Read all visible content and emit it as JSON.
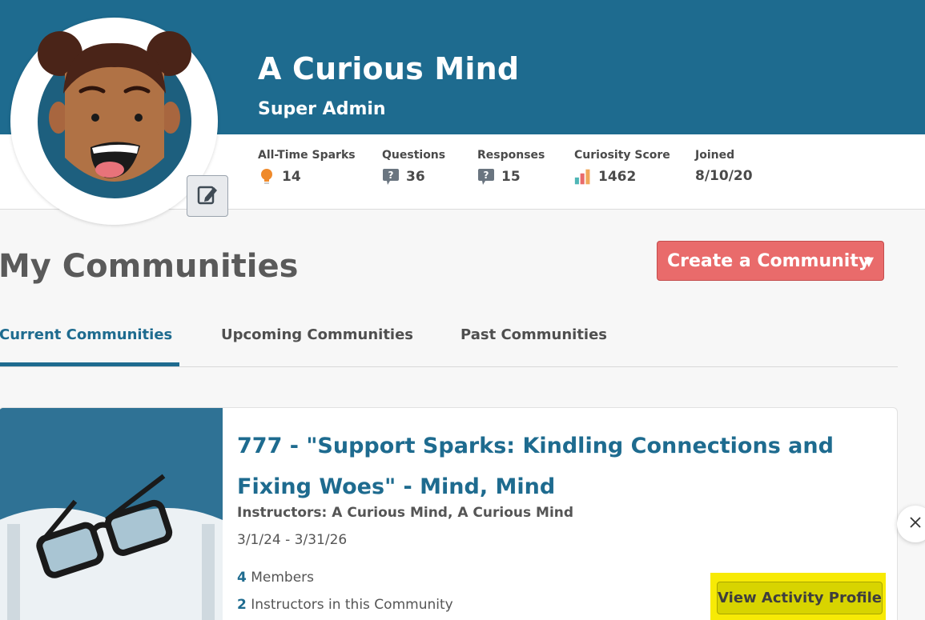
{
  "profile": {
    "name": "A Curious Mind",
    "role": "Super Admin",
    "avatar_icon": "girl-avatar-icon",
    "edit_icon": "edit-pencil-icon"
  },
  "stats": [
    {
      "label": "All-Time Sparks",
      "value": "14",
      "icon": "lightbulb-icon"
    },
    {
      "label": "Questions",
      "value": "36",
      "icon": "question-bubble-icon"
    },
    {
      "label": "Responses",
      "value": "15",
      "icon": "question-bubble-icon"
    },
    {
      "label": "Curiosity Score",
      "value": "1462",
      "icon": "bar-chart-icon"
    },
    {
      "label": "Joined",
      "value": "8/10/20",
      "icon": ""
    }
  ],
  "communities": {
    "title": "My Communities",
    "create_label": "Create a Community",
    "create_caret": "▼",
    "tabs": [
      {
        "label": "Current Communities",
        "active": true
      },
      {
        "label": "Upcoming Communities",
        "active": false
      },
      {
        "label": "Past Communities",
        "active": false
      }
    ]
  },
  "card": {
    "image_icon": "book-glasses-icon",
    "title": "777 - \"Support Sparks: Kindling Connections and Fixing Woes\" - Mind, Mind",
    "instructors": "Instructors: A Curious Mind, A Curious Mind",
    "dates": "3/1/24 - 3/31/26",
    "members_count": "4",
    "members_label": " Members",
    "instructors_count": "2",
    "instructors_label": " Instructors in this Community",
    "view_label": "View Activity Profile"
  },
  "floating": {
    "close_icon": "close-icon"
  },
  "colors": {
    "brand": "#1e6b8f",
    "create_button": "#e96b6b",
    "highlight": "#f7ea05"
  }
}
